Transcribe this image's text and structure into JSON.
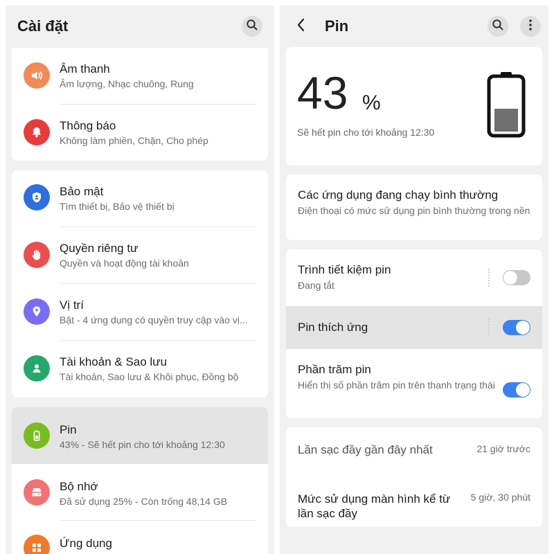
{
  "colors": {
    "accent": "#3b82f0",
    "sound_icon": "#f18a54",
    "notification_icon": "#ea3b3b",
    "security_icon": "#2d6fe0",
    "privacy_icon": "#ee4d4d",
    "location_icon": "#7a6df3",
    "account_icon": "#24a86b",
    "battery_icon": "#79bc1f",
    "storage_icon": "#f17272",
    "apps_icon": "#f07a2c"
  },
  "settings": {
    "title": "Cài đặt",
    "search_icon": "search-icon",
    "groups": [
      {
        "items": [
          {
            "icon": "speaker-icon",
            "title": "Âm thanh",
            "subtitle": "Âm lượng, Nhạc chuông, Rung"
          },
          {
            "icon": "bell-icon",
            "title": "Thông báo",
            "subtitle": "Không làm phiền, Chặn, Cho phép"
          }
        ]
      },
      {
        "items": [
          {
            "icon": "shield-icon",
            "title": "Bảo mật",
            "subtitle": "Tìm thiết bị, Bảo vệ thiết bị"
          },
          {
            "icon": "hand-icon",
            "title": "Quyền riêng tư",
            "subtitle": "Quyền và hoạt động tài khoản"
          },
          {
            "icon": "location-pin-icon",
            "title": "Vị trí",
            "subtitle": "Bật - 4 ứng dụng có quyền truy cập vào vị..."
          },
          {
            "icon": "person-icon",
            "title": "Tài khoản & Sao lưu",
            "subtitle": "Tài khoản, Sao lưu & Khôi phục, Đồng bộ"
          }
        ]
      },
      {
        "items": [
          {
            "icon": "battery-icon",
            "title": "Pin",
            "subtitle": "43% - Sẽ hết pin cho tới khoảng 12:30",
            "selected": true
          },
          {
            "icon": "storage-icon",
            "title": "Bộ nhớ",
            "subtitle": "Đã sử dụng 25% - Còn trống 48,14 GB"
          },
          {
            "icon": "apps-icon",
            "title": "Ứng dụng",
            "subtitle": ""
          }
        ]
      }
    ]
  },
  "battery": {
    "title": "Pin",
    "level_value": "43",
    "level_unit": "%",
    "level_fraction": 0.43,
    "estimate": "Sẽ hết pin cho tới khoảng 12:30",
    "apps_status": {
      "title": "Các ứng dụng đang chạy bình thường",
      "subtitle": "Điện thoại có mức sử dụng pin bình thường trong nền"
    },
    "power_saver": {
      "title": "Trình tiết kiệm pin",
      "subtitle": "Đang tắt",
      "enabled": false
    },
    "adaptive": {
      "title": "Pin thích ứng",
      "enabled": true
    },
    "percentage": {
      "title": "Phần trăm pin",
      "subtitle": "Hiển thị số phần trăm pin trên thanh trạng thái",
      "enabled": true
    },
    "last_charge": {
      "label": "Lần sạc đầy gần đây nhất",
      "value": "21 giờ trước"
    },
    "screen_usage": {
      "label": "Mức sử dụng màn hình kể từ lần sạc đầy",
      "value": "5 giờ, 30 phút"
    }
  }
}
